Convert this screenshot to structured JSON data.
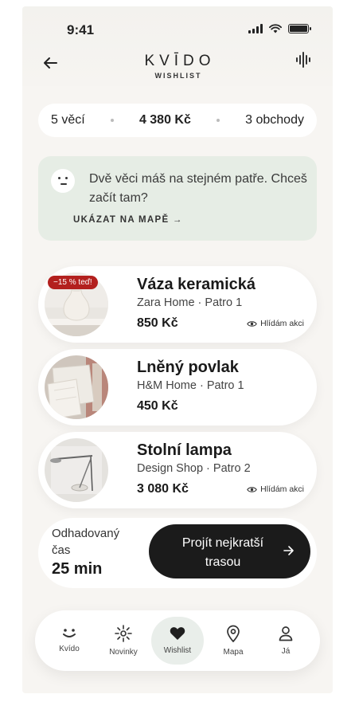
{
  "status_bar": {
    "time": "9:41"
  },
  "header": {
    "brand": "KVĪDO",
    "subtitle": "WISHLIST"
  },
  "summary": {
    "items": "5 věcí",
    "total": "4 380 Kč",
    "stores": "3 obchody"
  },
  "tip": {
    "text": "Dvě věci máš na stejném patře. Chceš začít tam?",
    "link": "UKÁZAT NA MAPĚ →"
  },
  "items": [
    {
      "name": "Váza keramická",
      "store": "Zara Home · Patro 1",
      "price": "850 Kč",
      "badge": "−15 % teď!",
      "watch": "Hlídám akci"
    },
    {
      "name": "Lněný povlak",
      "store": "H&M Home · Patro 1",
      "price": "450 Kč"
    },
    {
      "name": "Stolní lampa",
      "store": "Design Shop · Patro 2",
      "price": "3 080 Kč",
      "watch": "Hlídám akci"
    }
  ],
  "route": {
    "label": "Odhadovaný čas",
    "time": "25 min",
    "button": "Projít nejkratší trasou"
  },
  "nav": [
    {
      "label": "Kvído",
      "icon": "smile-icon"
    },
    {
      "label": "Novinky",
      "icon": "sparkle-icon"
    },
    {
      "label": "Wishlist",
      "icon": "heart-icon",
      "active": true
    },
    {
      "label": "Mapa",
      "icon": "map-pin-icon"
    },
    {
      "label": "Já",
      "icon": "user-icon"
    }
  ],
  "colors": {
    "accent_dark": "#1b1b1b",
    "tip_bg": "#e6ede5",
    "sale_red": "#b3201e",
    "nav_active_bg": "#e9eeea"
  }
}
